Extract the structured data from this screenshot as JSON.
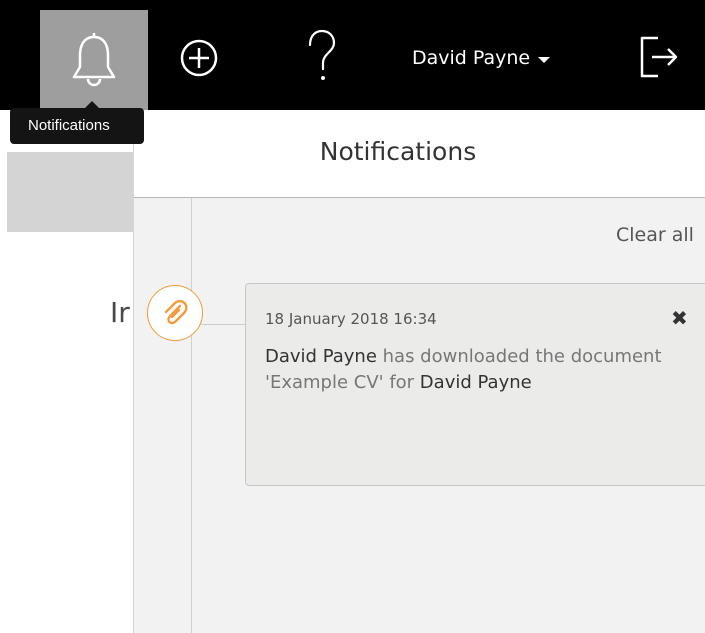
{
  "header": {
    "user_name": "David Payne",
    "tooltip": "Notifications"
  },
  "background": {
    "partial_heading": "Ir"
  },
  "notifications_panel": {
    "title": "Notifications",
    "clear_all_label": "Clear all",
    "items": [
      {
        "icon": "paperclip-icon",
        "timestamp": "18 January 2018 16:34",
        "actor": "David Payne",
        "action_text": "has downloaded the document 'Example CV' for",
        "subject": "David Payne"
      }
    ]
  },
  "colors": {
    "topbar_bg": "#000000",
    "active_tab_bg": "#9e9e9e",
    "accent_orange": "#f29a3a",
    "panel_bg": "#f2f2f2",
    "card_bg": "#ebebea"
  }
}
